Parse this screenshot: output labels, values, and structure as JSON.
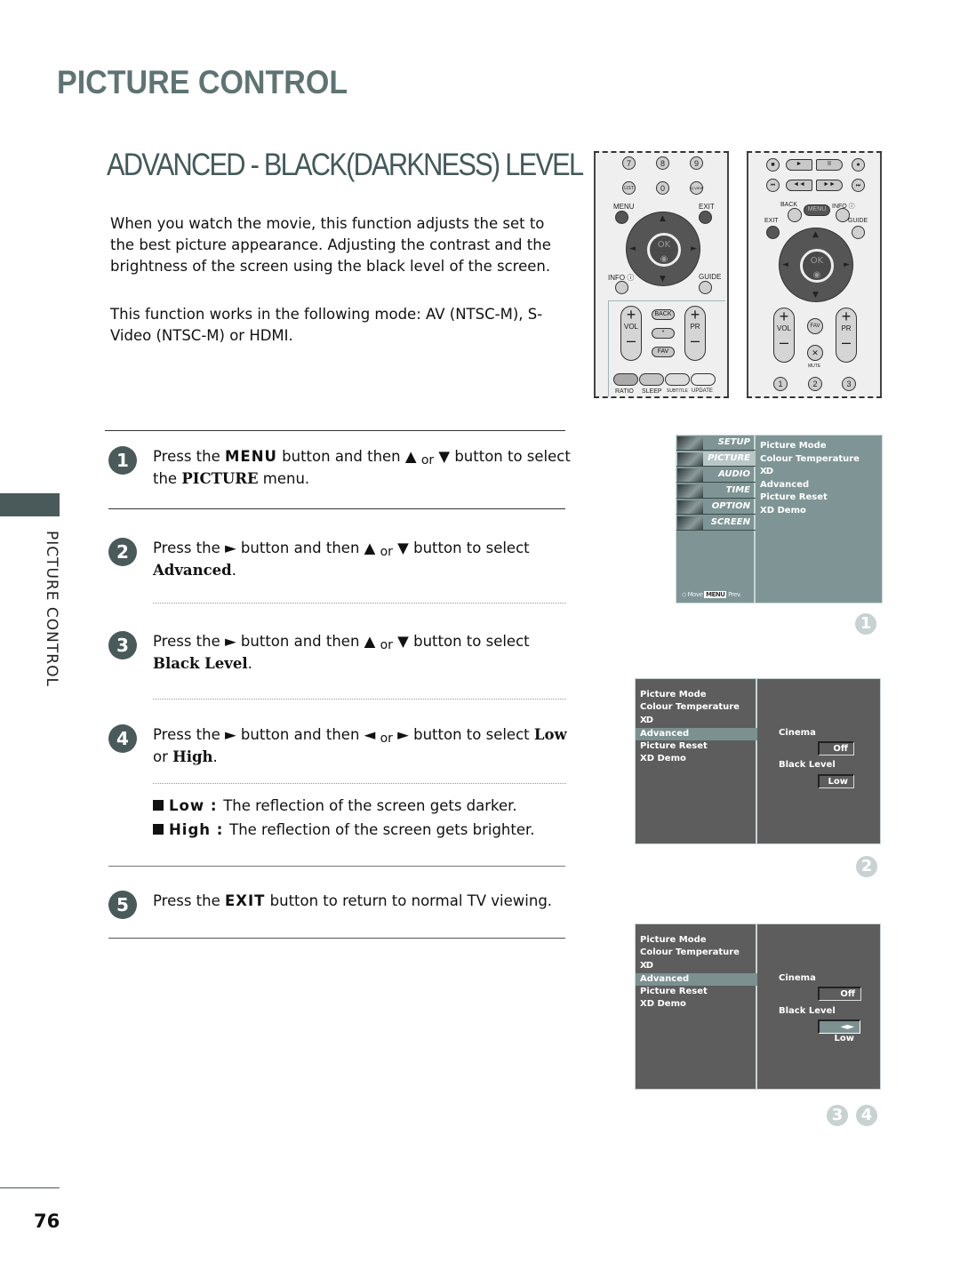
{
  "header": {
    "section_title": "PICTURE CONTROL",
    "sub_title": "ADVANCED - BLACK(DARKNESS) LEVEL"
  },
  "intro": {
    "paragraph1": "When you watch the movie, this function adjusts the set to the best picture appearance. Adjusting the contrast and the brightness of the screen using the black level of the screen.",
    "paragraph2": "This function works in the following mode: AV (NTSC-M), S-Video (NTSC-M) or HDMI."
  },
  "side_tab": {
    "label": "PICTURE CONTROL"
  },
  "steps": [
    {
      "number": "1",
      "pre": "Press the ",
      "key": "MENU",
      "mid": " button and then ▲ ",
      "or": "or",
      "post": " ▼ button to select the ",
      "target": "PICTURE",
      "end": " menu."
    },
    {
      "number": "2",
      "pre": "Press the ► button and then ▲ ",
      "or": "or",
      "post": " ▼ button to select ",
      "target": "Advanced",
      "end": "."
    },
    {
      "number": "3",
      "pre": "Press the ► button and then ▲ ",
      "or": "or",
      "post": " ▼ button to select ",
      "target": "Black Level",
      "end": "."
    },
    {
      "number": "4",
      "pre": "Press the ► button and then ◄ ",
      "or": "or",
      "post": " ► button to select ",
      "target": "Low",
      "mid2": " or ",
      "target2": "High",
      "end": "."
    },
    {
      "number": "5",
      "pre": "Press the ",
      "key": "EXIT",
      "post": " button to return to normal TV viewing."
    }
  ],
  "options": [
    {
      "name": "Low",
      "desc": "The reflection of the screen gets darker."
    },
    {
      "name": "High",
      "desc": "The reflection of the screen gets brighter."
    }
  ],
  "remote1": {
    "numbers": [
      "7",
      "8",
      "9",
      "0"
    ],
    "list": "LIST",
    "qview": "Q.VIEW",
    "menu": "MENU",
    "exit": "EXIT",
    "ok": "OK",
    "info": "INFO ⓘ",
    "guide": "GUIDE",
    "vol": "VOL",
    "pr": "PR",
    "back": "BACK",
    "star": "*",
    "fav": "FAV",
    "color_labels": [
      "RATIO",
      "SLEEP",
      "SUBTITLE",
      "UPDATE"
    ]
  },
  "remote2": {
    "transport_row1": [
      "■",
      "►",
      "II",
      "●"
    ],
    "transport_row2": [
      "⏮",
      "◄◄",
      "►►",
      "⏭"
    ],
    "back": "BACK",
    "menu": "MENU",
    "info": "INFO ⓘ",
    "exit": "EXIT",
    "guide": "GUIDE",
    "ok": "OK",
    "vol": "VOL",
    "pr": "PR",
    "fav": "FAV",
    "mute": "MUTE",
    "numbers": [
      "1",
      "2",
      "3"
    ]
  },
  "osd1": {
    "menu_items": [
      "SETUP",
      "PICTURE",
      "AUDIO",
      "TIME",
      "OPTION",
      "SCREEN"
    ],
    "selected": "PICTURE",
    "submenu": [
      "Picture Mode",
      "Colour Temperature",
      "XD",
      "Advanced",
      "Picture Reset",
      "XD Demo"
    ],
    "hint_move": "◇ Move",
    "hint_menu_key": "MENU",
    "hint_prev": "Prev.",
    "marker": "1"
  },
  "osd2": {
    "submenu": [
      "Picture Mode",
      "Colour Temperature",
      "XD",
      "Advanced",
      "Picture Reset",
      "XD Demo"
    ],
    "selected": "Advanced",
    "cinema_label": "Cinema",
    "cinema_value": "Off",
    "black_level_label": "Black Level",
    "black_level_value": "Low",
    "marker": "2"
  },
  "osd3": {
    "submenu": [
      "Picture Mode",
      "Colour Temperature",
      "XD",
      "Advanced",
      "Picture Reset",
      "XD Demo"
    ],
    "selected": "Advanced",
    "cinema_label": "Cinema",
    "cinema_value": "Off",
    "black_level_label": "Black Level",
    "black_level_value": "◄► Low",
    "markers": [
      "3",
      "4"
    ]
  },
  "footer": {
    "page_number": "76"
  },
  "colors": {
    "accent": "#4a5a5a",
    "title": "#5f7373",
    "osd_menu_bg": "#7f9595",
    "osd_panel_bg": "#5d5d5d",
    "osd_highlight": "#7c9090"
  }
}
